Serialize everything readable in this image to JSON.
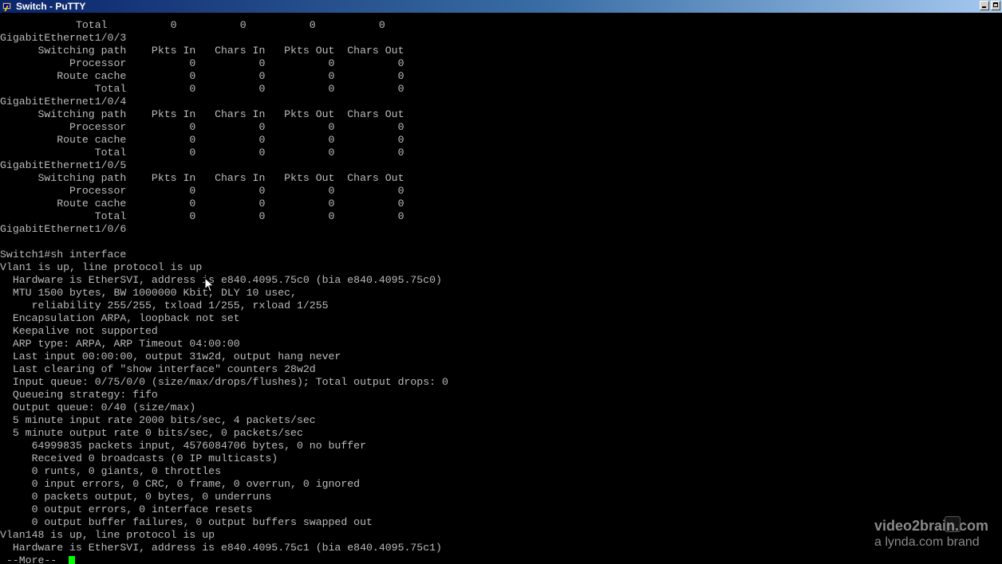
{
  "window": {
    "title": "Switch - PuTTY",
    "icon": "putty-icon",
    "buttons": [
      "minimize-icon",
      "maximize-icon"
    ]
  },
  "terminal": {
    "lines": [
      "            Total          0          0          0          0",
      "GigabitEthernet1/0/3",
      "      Switching path    Pkts In   Chars In   Pkts Out  Chars Out",
      "           Processor          0          0          0          0",
      "         Route cache          0          0          0          0",
      "               Total          0          0          0          0",
      "GigabitEthernet1/0/4",
      "      Switching path    Pkts In   Chars In   Pkts Out  Chars Out",
      "           Processor          0          0          0          0",
      "         Route cache          0          0          0          0",
      "               Total          0          0          0          0",
      "GigabitEthernet1/0/5",
      "      Switching path    Pkts In   Chars In   Pkts Out  Chars Out",
      "           Processor          0          0          0          0",
      "         Route cache          0          0          0          0",
      "               Total          0          0          0          0",
      "GigabitEthernet1/0/6",
      "",
      "Switch1#sh interface",
      "Vlan1 is up, line protocol is up",
      "  Hardware is EtherSVI, address is e840.4095.75c0 (bia e840.4095.75c0)",
      "  MTU 1500 bytes, BW 1000000 Kbit, DLY 10 usec,",
      "     reliability 255/255, txload 1/255, rxload 1/255",
      "  Encapsulation ARPA, loopback not set",
      "  Keepalive not supported",
      "  ARP type: ARPA, ARP Timeout 04:00:00",
      "  Last input 00:00:00, output 31w2d, output hang never",
      "  Last clearing of \"show interface\" counters 28w2d",
      "  Input queue: 0/75/0/0 (size/max/drops/flushes); Total output drops: 0",
      "  Queueing strategy: fifo",
      "  Output queue: 0/40 (size/max)",
      "  5 minute input rate 2000 bits/sec, 4 packets/sec",
      "  5 minute output rate 0 bits/sec, 0 packets/sec",
      "     64999835 packets input, 4576084706 bytes, 0 no buffer",
      "     Received 0 broadcasts (0 IP multicasts)",
      "     0 runts, 0 giants, 0 throttles",
      "     0 input errors, 0 CRC, 0 frame, 0 overrun, 0 ignored",
      "     0 packets output, 0 bytes, 0 underruns",
      "     0 output errors, 0 interface resets",
      "     0 output buffer failures, 0 output buffers swapped out",
      "Vlan148 is up, line protocol is up",
      "  Hardware is EtherSVI, address is e840.4095.75c1 (bia e840.4095.75c1)"
    ],
    "more_prompt": " --More-- ",
    "cursor_color": "#00ff00",
    "text_color": "#bbbbbb",
    "background_color": "#000000"
  },
  "watermark": {
    "line1": "video2brain.com",
    "line2": "a lynda.com brand"
  }
}
